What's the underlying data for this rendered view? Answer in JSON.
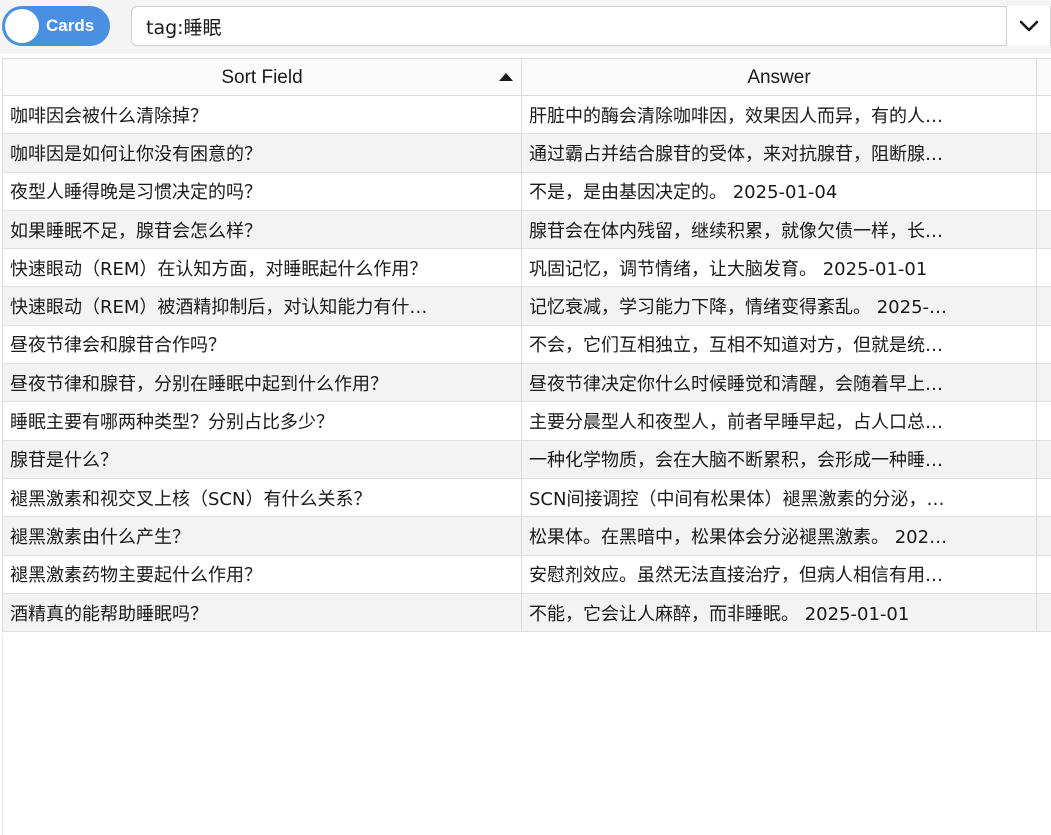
{
  "toolbar": {
    "toggle_label": "Cards",
    "search_value": "tag:睡眠"
  },
  "columns": {
    "sort_field": "Sort Field",
    "answer": "Answer"
  },
  "rows": [
    {
      "question": "咖啡因会被什么清除掉？",
      "answer": "肝脏中的酶会清除咖啡因，效果因人而异，有的人…"
    },
    {
      "question": "咖啡因是如何让你没有困意的？",
      "answer": "通过霸占并结合腺苷的受体，来对抗腺苷，阻断腺…"
    },
    {
      "question": "夜型人睡得晚是习惯决定的吗？",
      "answer": "不是，是由基因决定的。   2025-01-04"
    },
    {
      "question": "如果睡眠不足，腺苷会怎么样？",
      "answer": "腺苷会在体内残留，继续积累，就像欠债一样，长…"
    },
    {
      "question": "快速眼动（REM）在认知方面，对睡眠起什么作用？",
      "answer": "巩固记忆，调节情绪，让大脑发育。   2025-01-01"
    },
    {
      "question": "快速眼动（REM）被酒精抑制后，对认知能力有什…",
      "answer": "记忆衰减，学习能力下降，情绪变得紊乱。   2025-…"
    },
    {
      "question": "昼夜节律会和腺苷合作吗？",
      "answer": "不会，它们互相独立，互相不知道对方，但就是统…"
    },
    {
      "question": "昼夜节律和腺苷，分别在睡眠中起到什么作用？",
      "answer": "昼夜节律决定你什么时候睡觉和清醒，会随着早上…"
    },
    {
      "question": "睡眠主要有哪两种类型？分别占比多少？",
      "answer": "主要分晨型人和夜型人，前者早睡早起，占人口总…"
    },
    {
      "question": "腺苷是什么？",
      "answer": "一种化学物质，会在大脑不断累积，会形成一种睡…"
    },
    {
      "question": "褪黑激素和视交叉上核（SCN）有什么关系？",
      "answer": "SCN间接调控（中间有松果体）褪黑激素的分泌，…"
    },
    {
      "question": "褪黑激素由什么产生？",
      "answer": "松果体。在黑暗中，松果体会分泌褪黑激素。   202…"
    },
    {
      "question": "褪黑激素药物主要起什么作用？",
      "answer": "安慰剂效应。虽然无法直接治疗，但病人相信有用…"
    },
    {
      "question": "酒精真的能帮助睡眠吗？",
      "answer": "不能，它会让人麻醉，而非睡眠。   2025-01-01"
    }
  ]
}
